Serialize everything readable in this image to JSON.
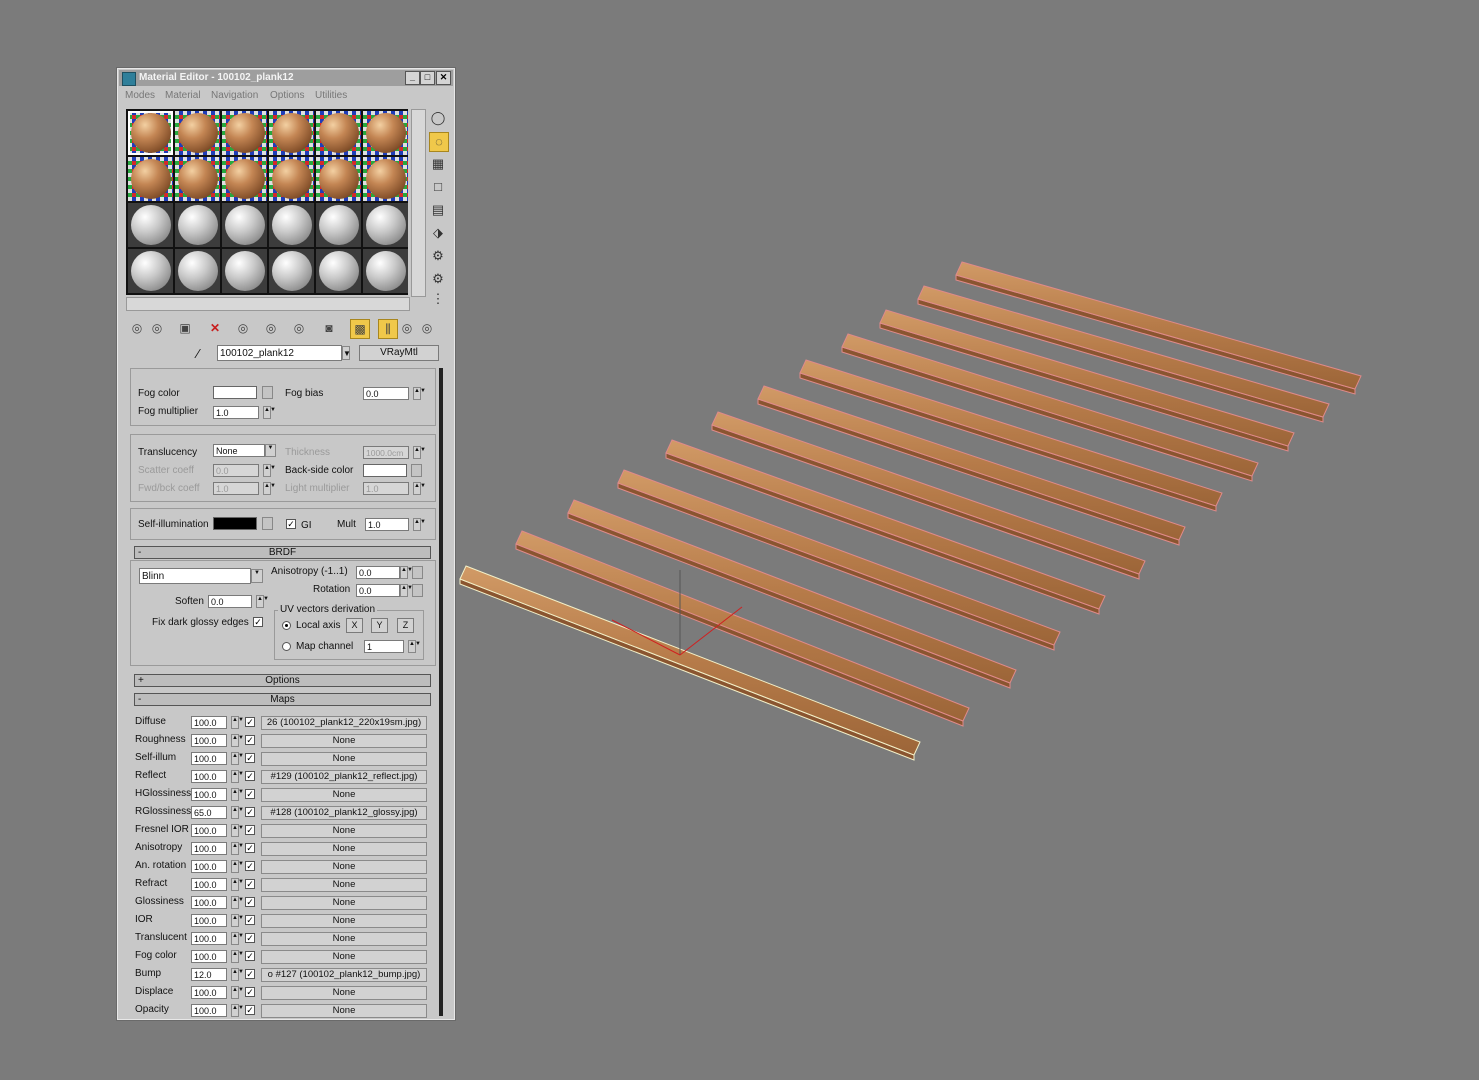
{
  "window": {
    "title": "Material Editor - 100102_plank12",
    "controls": [
      "_",
      "□",
      "✕"
    ]
  },
  "menu": [
    "Modes",
    "Material",
    "Navigation",
    "Options",
    "Utilities"
  ],
  "material": {
    "name": "100102_plank12",
    "type": "VRayMtl"
  },
  "fog": {
    "color_label": "Fog color",
    "color": "#ffffff",
    "multiplier_label": "Fog multiplier",
    "multiplier": "1.0",
    "bias_label": "Fog bias",
    "bias": "0.0"
  },
  "translucency": {
    "label": "Translucency",
    "value": "None",
    "thickness_label": "Thickness",
    "thickness": "1000.0cm",
    "scatter_label": "Scatter coeff",
    "scatter": "0.0",
    "backside_label": "Back-side color",
    "fwdbck_label": "Fwd/bck coeff",
    "fwdbck": "1.0",
    "light_mult_label": "Light multiplier",
    "light_mult": "1.0"
  },
  "self_illum": {
    "label": "Self-illumination",
    "color": "#000000",
    "gi_label": "GI",
    "mult_label": "Mult",
    "mult": "1.0"
  },
  "brdf": {
    "title": "BRDF",
    "type": "Blinn",
    "anisotropy_label": "Anisotropy (-1..1)",
    "anisotropy": "0.0",
    "rotation_label": "Rotation",
    "rotation": "0.0",
    "soften_label": "Soften",
    "soften": "0.0",
    "fix_label": "Fix dark glossy edges",
    "uv_group": "UV vectors derivation",
    "local_axis": "Local axis",
    "axes": [
      "X",
      "Y",
      "Z"
    ],
    "map_channel_label": "Map channel",
    "map_channel": "1"
  },
  "options_title": "Options",
  "maps_title": "Maps",
  "maps": [
    {
      "name": "Diffuse",
      "amount": "100.0",
      "map": "26 (100102_plank12_220x19sm.jpg)"
    },
    {
      "name": "Roughness",
      "amount": "100.0",
      "map": "None"
    },
    {
      "name": "Self-illum",
      "amount": "100.0",
      "map": "None"
    },
    {
      "name": "Reflect",
      "amount": "100.0",
      "map": "#129 (100102_plank12_reflect.jpg)"
    },
    {
      "name": "HGlossiness",
      "amount": "100.0",
      "map": "None"
    },
    {
      "name": "RGlossiness",
      "amount": "65.0",
      "map": "#128 (100102_plank12_glossy.jpg)"
    },
    {
      "name": "Fresnel IOR",
      "amount": "100.0",
      "map": "None"
    },
    {
      "name": "Anisotropy",
      "amount": "100.0",
      "map": "None"
    },
    {
      "name": "An. rotation",
      "amount": "100.0",
      "map": "None"
    },
    {
      "name": "Refract",
      "amount": "100.0",
      "map": "None"
    },
    {
      "name": "Glossiness",
      "amount": "100.0",
      "map": "None"
    },
    {
      "name": "IOR",
      "amount": "100.0",
      "map": "None"
    },
    {
      "name": "Translucent",
      "amount": "100.0",
      "map": "None"
    },
    {
      "name": "Fog color",
      "amount": "100.0",
      "map": "None"
    },
    {
      "name": "Bump",
      "amount": "12.0",
      "map": "o #127 (100102_plank12_bump.jpg)"
    },
    {
      "name": "Displace",
      "amount": "100.0",
      "map": "None"
    },
    {
      "name": "Opacity",
      "amount": "100.0",
      "map": "None"
    }
  ],
  "colors": {
    "viewport_bg": "#7b7b7b",
    "wood": "#b47a4a",
    "selected_outline": "#f3f0c8",
    "plank_outline": "#e08a8a"
  }
}
